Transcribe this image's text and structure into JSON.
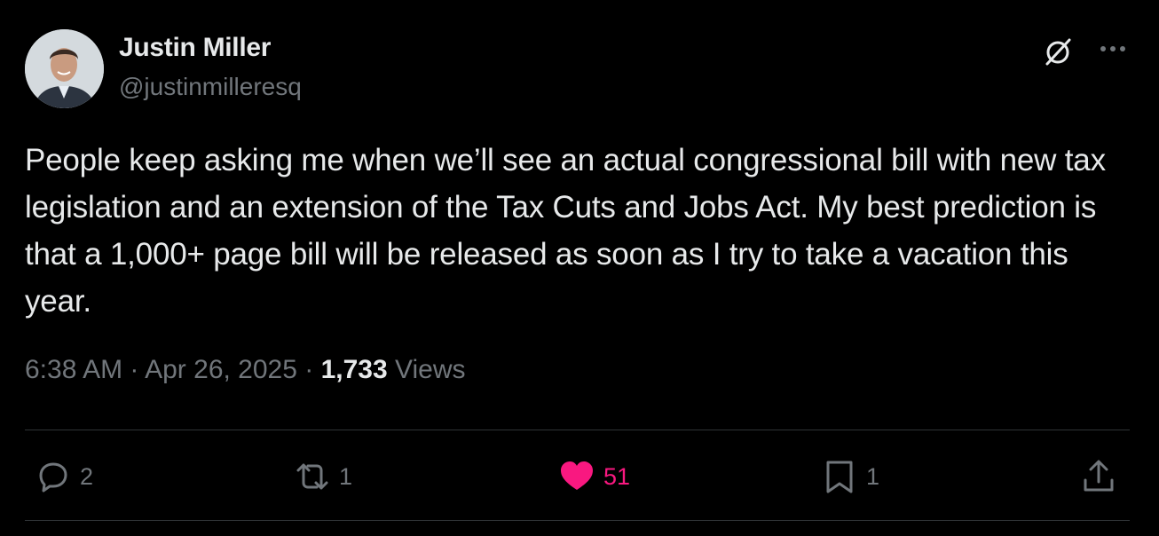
{
  "author": {
    "name": "Justin Miller",
    "handle": "@justinmilleresq"
  },
  "icons": {
    "grok": "grok-icon",
    "more": "more-icon",
    "reply": "reply-icon",
    "repost": "repost-icon",
    "like": "heart-filled-icon",
    "bookmark": "bookmark-icon",
    "share": "share-icon"
  },
  "tweet": {
    "text": "People keep asking me when we’ll see an actual congressional bill with new tax legislation and an extension of the Tax Cuts and Jobs Act. My best prediction is that a 1,000+ page bill will be released as soon as I try to take a vacation this year.",
    "time": "6:38 AM",
    "separator": "·",
    "date": "Apr 26, 2025",
    "views_count": "1,733",
    "views_label": "Views"
  },
  "actions": {
    "reply_count": "2",
    "repost_count": "1",
    "like_count": "51",
    "bookmark_count": "1"
  },
  "colors": {
    "background": "#000000",
    "text_primary": "#e7e9ea",
    "text_secondary": "#71767b",
    "like_active": "#f91880",
    "divider": "#2f3336"
  }
}
